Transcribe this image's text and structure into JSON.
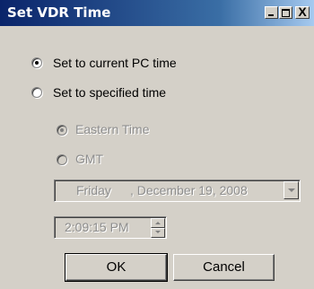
{
  "window": {
    "title": "Set VDR Time",
    "controls": {
      "minimize_icon": "minimize-icon",
      "maximize_icon": "maximize-icon",
      "close_icon": "close-icon",
      "close_glyph": "X"
    }
  },
  "options": {
    "current_pc_time": {
      "label": "Set to current PC time",
      "checked": true
    },
    "specified_time": {
      "label": "Set to specified time",
      "checked": false
    }
  },
  "timezone": {
    "eastern": {
      "label": "Eastern Time",
      "checked": true,
      "enabled": false
    },
    "gmt": {
      "label": "GMT",
      "checked": false,
      "enabled": false
    }
  },
  "date_field": {
    "day": "Friday",
    "date": ", December 19, 2008",
    "enabled": false
  },
  "time_field": {
    "value": "2:09:15 PM",
    "enabled": false
  },
  "buttons": {
    "ok": "OK",
    "cancel": "Cancel"
  }
}
